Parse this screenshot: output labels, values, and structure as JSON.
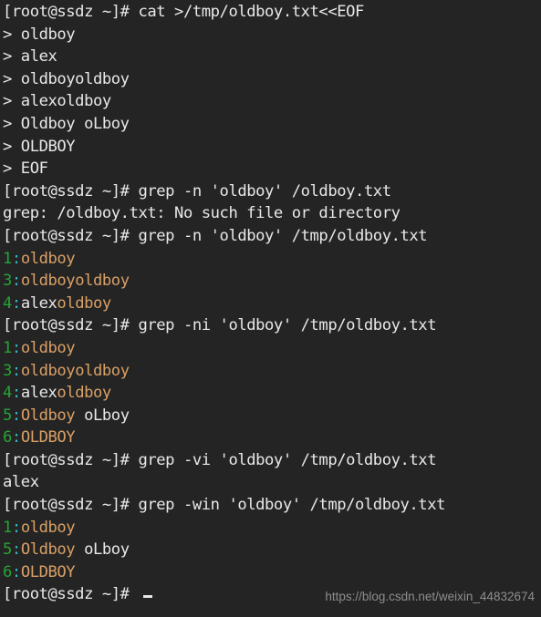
{
  "terminal": {
    "background_color": "#242424",
    "foreground_color": "#e8e8e8",
    "prompt": "[root@ssdz ~]# ",
    "heredoc_prompt": "> ",
    "colors": {
      "line_number": "#26a236",
      "separator": "#35b8c4",
      "match": "#d9a066",
      "normal": "#e8e8e8",
      "watermark": "#8e8e8e"
    },
    "lines": [
      {
        "name": "command-cat-heredoc",
        "segments": [
          {
            "text": "[root@ssdz ~]# ",
            "color": "normal"
          },
          {
            "text": "cat >/tmp/oldboy.txt<<EOF",
            "color": "normal"
          }
        ]
      },
      {
        "name": "heredoc-input-oldboy",
        "segments": [
          {
            "text": "> oldboy",
            "color": "normal"
          }
        ]
      },
      {
        "name": "heredoc-input-alex",
        "segments": [
          {
            "text": "> alex",
            "color": "normal"
          }
        ]
      },
      {
        "name": "heredoc-input-oldboyoldboy",
        "segments": [
          {
            "text": "> oldboyoldboy",
            "color": "normal"
          }
        ]
      },
      {
        "name": "heredoc-input-alexoldboy",
        "segments": [
          {
            "text": "> alexoldboy",
            "color": "normal"
          }
        ]
      },
      {
        "name": "heredoc-input-oldboy-olboy",
        "segments": [
          {
            "text": "> Oldboy oLboy",
            "color": "normal"
          }
        ]
      },
      {
        "name": "heredoc-input-OLDBOY",
        "segments": [
          {
            "text": "> OLDBOY",
            "color": "normal"
          }
        ]
      },
      {
        "name": "heredoc-terminator",
        "segments": [
          {
            "text": "> EOF",
            "color": "normal"
          }
        ]
      },
      {
        "name": "command-grep-n-badpath",
        "segments": [
          {
            "text": "[root@ssdz ~]# ",
            "color": "normal"
          },
          {
            "text": "grep -n 'oldboy' /oldboy.txt",
            "color": "normal"
          }
        ]
      },
      {
        "name": "output-error-no-such-file",
        "segments": [
          {
            "text": "grep: /oldboy.txt: No such file or directory",
            "color": "normal"
          }
        ]
      },
      {
        "name": "command-grep-n",
        "segments": [
          {
            "text": "[root@ssdz ~]# ",
            "color": "normal"
          },
          {
            "text": "grep -n 'oldboy' /tmp/oldboy.txt",
            "color": "normal"
          }
        ]
      },
      {
        "name": "output-grep-n-line1",
        "segments": [
          {
            "text": "1",
            "color": "line_number"
          },
          {
            "text": ":",
            "color": "separator"
          },
          {
            "text": "oldboy",
            "color": "match"
          }
        ]
      },
      {
        "name": "output-grep-n-line3",
        "segments": [
          {
            "text": "3",
            "color": "line_number"
          },
          {
            "text": ":",
            "color": "separator"
          },
          {
            "text": "oldboyoldboy",
            "color": "match"
          }
        ]
      },
      {
        "name": "output-grep-n-line4",
        "segments": [
          {
            "text": "4",
            "color": "line_number"
          },
          {
            "text": ":",
            "color": "separator"
          },
          {
            "text": "alex",
            "color": "normal"
          },
          {
            "text": "oldboy",
            "color": "match"
          }
        ]
      },
      {
        "name": "command-grep-ni",
        "segments": [
          {
            "text": "[root@ssdz ~]# ",
            "color": "normal"
          },
          {
            "text": "grep -ni 'oldboy' /tmp/oldboy.txt",
            "color": "normal"
          }
        ]
      },
      {
        "name": "output-grep-ni-line1",
        "segments": [
          {
            "text": "1",
            "color": "line_number"
          },
          {
            "text": ":",
            "color": "separator"
          },
          {
            "text": "oldboy",
            "color": "match"
          }
        ]
      },
      {
        "name": "output-grep-ni-line3",
        "segments": [
          {
            "text": "3",
            "color": "line_number"
          },
          {
            "text": ":",
            "color": "separator"
          },
          {
            "text": "oldboyoldboy",
            "color": "match"
          }
        ]
      },
      {
        "name": "output-grep-ni-line4",
        "segments": [
          {
            "text": "4",
            "color": "line_number"
          },
          {
            "text": ":",
            "color": "separator"
          },
          {
            "text": "alex",
            "color": "normal"
          },
          {
            "text": "oldboy",
            "color": "match"
          }
        ]
      },
      {
        "name": "output-grep-ni-line5",
        "segments": [
          {
            "text": "5",
            "color": "line_number"
          },
          {
            "text": ":",
            "color": "separator"
          },
          {
            "text": "Oldboy",
            "color": "match"
          },
          {
            "text": " oLboy",
            "color": "normal"
          }
        ]
      },
      {
        "name": "output-grep-ni-line6",
        "segments": [
          {
            "text": "6",
            "color": "line_number"
          },
          {
            "text": ":",
            "color": "separator"
          },
          {
            "text": "OLDBOY",
            "color": "match"
          }
        ]
      },
      {
        "name": "command-grep-vi",
        "segments": [
          {
            "text": "[root@ssdz ~]# ",
            "color": "normal"
          },
          {
            "text": "grep -vi 'oldboy' /tmp/oldboy.txt",
            "color": "normal"
          }
        ]
      },
      {
        "name": "output-grep-vi-alex",
        "segments": [
          {
            "text": "alex",
            "color": "normal"
          }
        ]
      },
      {
        "name": "command-grep-win",
        "segments": [
          {
            "text": "[root@ssdz ~]# ",
            "color": "normal"
          },
          {
            "text": "grep -win 'oldboy' /tmp/oldboy.txt",
            "color": "normal"
          }
        ]
      },
      {
        "name": "output-grep-win-line1",
        "segments": [
          {
            "text": "1",
            "color": "line_number"
          },
          {
            "text": ":",
            "color": "separator"
          },
          {
            "text": "oldboy",
            "color": "match"
          }
        ]
      },
      {
        "name": "output-grep-win-line5",
        "segments": [
          {
            "text": "5",
            "color": "line_number"
          },
          {
            "text": ":",
            "color": "separator"
          },
          {
            "text": "Oldboy",
            "color": "match"
          },
          {
            "text": " oLboy",
            "color": "normal"
          }
        ]
      },
      {
        "name": "output-grep-win-line6",
        "segments": [
          {
            "text": "6",
            "color": "line_number"
          },
          {
            "text": ":",
            "color": "separator"
          },
          {
            "text": "OLDBOY",
            "color": "match"
          }
        ]
      },
      {
        "name": "prompt-active",
        "cursor": true,
        "segments": [
          {
            "text": "[root@ssdz ~]# ",
            "color": "normal"
          }
        ]
      }
    ]
  },
  "watermark": {
    "text": "https://blog.csdn.net/weixin_44832674"
  }
}
